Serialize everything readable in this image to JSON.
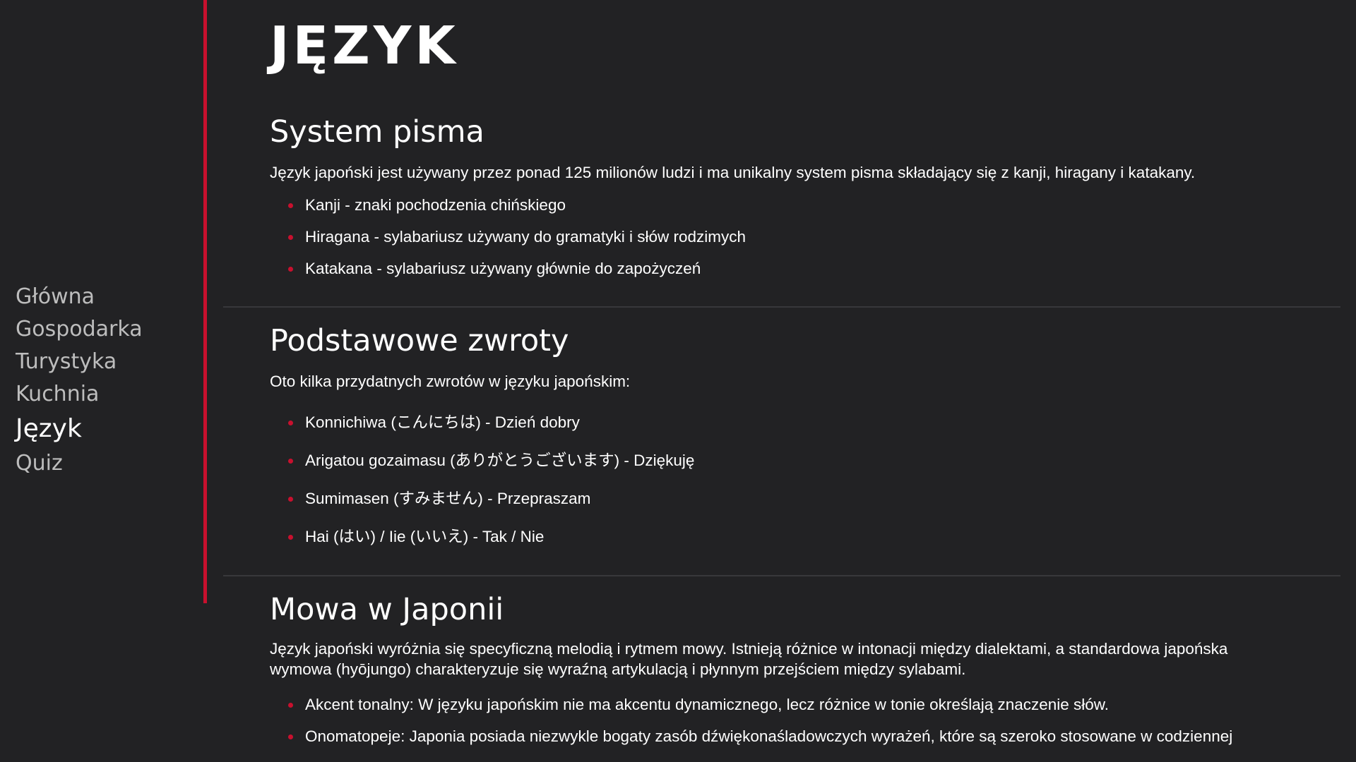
{
  "nav": {
    "items": [
      {
        "label": "Główna",
        "active": false
      },
      {
        "label": "Gospodarka",
        "active": false
      },
      {
        "label": "Turystyka",
        "active": false
      },
      {
        "label": "Kuchnia",
        "active": false
      },
      {
        "label": "Język",
        "active": true
      },
      {
        "label": "Quiz",
        "active": false
      }
    ]
  },
  "page": {
    "title": "JĘZYK"
  },
  "sections": {
    "writing": {
      "heading": "System pisma",
      "intro": "Język japoński jest używany przez ponad 125 milionów ludzi i ma unikalny system pisma składający się z kanji, hiragany i katakany.",
      "items": [
        "Kanji - znaki pochodzenia chińskiego",
        "Hiragana - sylabariusz używany do gramatyki i słów rodzimych",
        "Katakana - sylabariusz używany głównie do zapożyczeń"
      ]
    },
    "phrases": {
      "heading": "Podstawowe zwroty",
      "intro": "Oto kilka przydatnych zwrotów w języku japońskim:",
      "items": [
        "Konnichiwa (こんにちは) - Dzień dobry",
        "Arigatou gozaimasu (ありがとうございます) - Dziękuję",
        "Sumimasen (すみません) - Przepraszam",
        "Hai (はい) / Iie (いいえ) - Tak / Nie"
      ]
    },
    "speech": {
      "heading": "Mowa w Japonii",
      "intro": "Język japoński wyróżnia się specyficzną melodią i rytmem mowy. Istnieją różnice w intonacji między dialektami, a standardowa japońska wymowa (hyōjungo) charakteryzuje się wyraźną artykulacją i płynnym przejściem między sylabami.",
      "items": [
        "Akcent tonalny: W języku japońskim nie ma akcentu dynamicznego, lecz różnice w tonie określają znaczenie słów.",
        "Onomatopeje: Japonia posiada niezwykle bogaty zasób dźwiękonaśladowczych wyrażeń, które są szeroko stosowane w codziennej"
      ]
    }
  },
  "colors": {
    "background": "#222224",
    "accent": "#c8102e",
    "nav_inactive": "#bdbdbd",
    "text": "#ffffff",
    "divider": "#38383b"
  }
}
